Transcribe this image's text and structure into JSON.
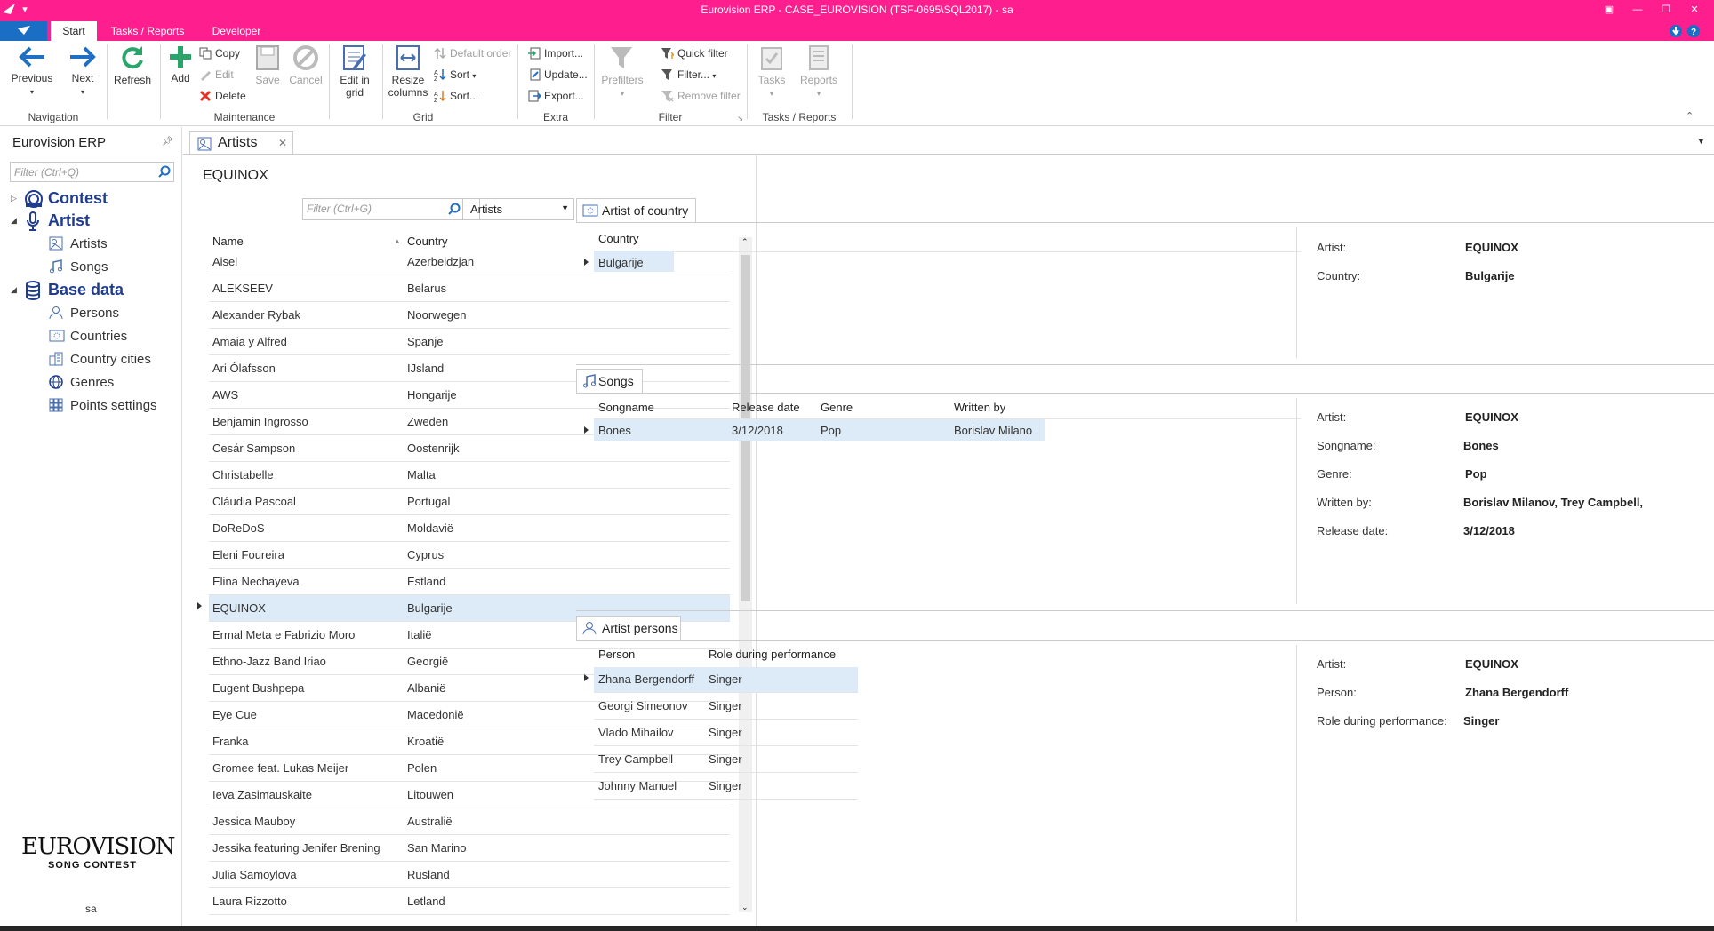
{
  "window": {
    "title": "Eurovision ERP - CASE_EUROVISION (TSF-0695\\SQL2017) - sa"
  },
  "ribbon_tabs": [
    "Start",
    "Tasks / Reports",
    "Developer"
  ],
  "ribbon": {
    "previous": "Previous",
    "next": "Next",
    "refresh": "Refresh",
    "navigation": "Navigation",
    "add": "Add",
    "copy": "Copy",
    "edit": "Edit",
    "delete": "Delete",
    "save": "Save",
    "cancel": "Cancel",
    "maintenance": "Maintenance",
    "edit_in": "Edit in",
    "grid_word": "grid",
    "resize": "Resize",
    "columns": "columns",
    "default_order": "Default order",
    "sort": "Sort",
    "sort_dialog": "Sort...",
    "grid": "Grid",
    "import": "Import...",
    "update": "Update...",
    "export": "Export...",
    "extra": "Extra",
    "prefilters": "Prefilters",
    "quick_filter": "Quick filter",
    "filter": "Filter...",
    "remove_filter": "Remove filter",
    "filter_group": "Filter",
    "tasks": "Tasks",
    "reports": "Reports",
    "tasks_reports": "Tasks / Reports"
  },
  "left_panel": {
    "title": "Eurovision ERP",
    "filter_placeholder": "Filter (Ctrl+Q)",
    "contest": "Contest",
    "artist": "Artist",
    "artists": "Artists",
    "songs": "Songs",
    "base_data": "Base data",
    "persons": "Persons",
    "countries": "Countries",
    "country_cities": "Country cities",
    "genres": "Genres",
    "points_settings": "Points settings",
    "logo_word": "EUROVISION",
    "logo_sub": "SONG CONTEST",
    "user": "sa"
  },
  "document": {
    "tab": "Artists",
    "heading": "EQUINOX",
    "grid_filter_placeholder": "Filter (Ctrl+G)",
    "grid_combo": "Artists",
    "col_name": "Name",
    "col_country": "Country",
    "rows": [
      {
        "name": "Aisel",
        "country": "Azerbeidzjan"
      },
      {
        "name": "ALEKSEEV",
        "country": "Belarus"
      },
      {
        "name": "Alexander Rybak",
        "country": "Noorwegen"
      },
      {
        "name": "Amaia y Alfred",
        "country": "Spanje"
      },
      {
        "name": "Ari Ólafsson",
        "country": "IJsland"
      },
      {
        "name": "AWS",
        "country": "Hongarije"
      },
      {
        "name": "Benjamin Ingrosso",
        "country": "Zweden"
      },
      {
        "name": "Cesár Sampson",
        "country": "Oostenrijk"
      },
      {
        "name": "Christabelle",
        "country": "Malta"
      },
      {
        "name": "Cláudia Pascoal",
        "country": "Portugal"
      },
      {
        "name": "DoReDoS",
        "country": "Moldavië"
      },
      {
        "name": "Eleni Foureira",
        "country": "Cyprus"
      },
      {
        "name": "Elina Nechayeva",
        "country": "Estland"
      },
      {
        "name": "EQUINOX",
        "country": "Bulgarije"
      },
      {
        "name": "Ermal Meta e Fabrizio Moro",
        "country": "Italië"
      },
      {
        "name": "Ethno-Jazz Band Iriao",
        "country": "Georgië"
      },
      {
        "name": "Eugent Bushpepa",
        "country": "Albanië"
      },
      {
        "name": "Eye Cue",
        "country": "Macedonië"
      },
      {
        "name": "Franka",
        "country": "Kroatië"
      },
      {
        "name": "Gromee feat. Lukas Meijer",
        "country": "Polen"
      },
      {
        "name": "Ieva Zasimauskaite",
        "country": "Litouwen"
      },
      {
        "name": "Jessica Mauboy",
        "country": "Australië"
      },
      {
        "name": "Jessika featuring Jenifer Brening",
        "country": "San Marino"
      },
      {
        "name": "Julia Samoylova",
        "country": "Rusland"
      },
      {
        "name": "Laura Rizzotto",
        "country": "Letland"
      }
    ],
    "aoc": {
      "tab": "Artist of country",
      "col_country": "Country",
      "row_country": "Bulgarije",
      "lbl_artist": "Artist:",
      "val_artist": "EQUINOX",
      "lbl_country": "Country:",
      "val_country": "Bulgarije"
    },
    "songs": {
      "tab": "Songs",
      "col_songname": "Songname",
      "col_release": "Release date",
      "col_genre": "Genre",
      "col_written": "Written by",
      "row": {
        "songname": "Bones",
        "release": "3/12/2018",
        "genre": "Pop",
        "written": "Borislav Milano"
      },
      "lbl_artist": "Artist:",
      "val_artist": "EQUINOX",
      "lbl_songname": "Songname:",
      "val_songname": "Bones",
      "lbl_genre": "Genre:",
      "val_genre": "Pop",
      "lbl_written": "Written by:",
      "val_written": "Borislav Milanov, Trey Campbell,",
      "lbl_release": "Release date:",
      "val_release": "3/12/2018"
    },
    "persons": {
      "tab": "Artist persons",
      "col_person": "Person",
      "col_role": "Role during performance",
      "rows": [
        {
          "person": "Zhana Bergendorff",
          "role": "Singer"
        },
        {
          "person": "Georgi Simeonov",
          "role": "Singer"
        },
        {
          "person": "Vlado Mihailov",
          "role": "Singer"
        },
        {
          "person": "Trey Campbell",
          "role": "Singer"
        },
        {
          "person": "Johnny Manuel",
          "role": "Singer"
        }
      ],
      "lbl_artist": "Artist:",
      "val_artist": "EQUINOX",
      "lbl_person": "Person:",
      "val_person": "Zhana Bergendorff",
      "lbl_role": "Role during performance:",
      "val_role": "Singer"
    }
  },
  "colors": {
    "accent": "#ff1e8e",
    "app_blue": "#1a6fc4",
    "tree_heading": "#1f3c8f",
    "selection": "#dcebf7"
  }
}
